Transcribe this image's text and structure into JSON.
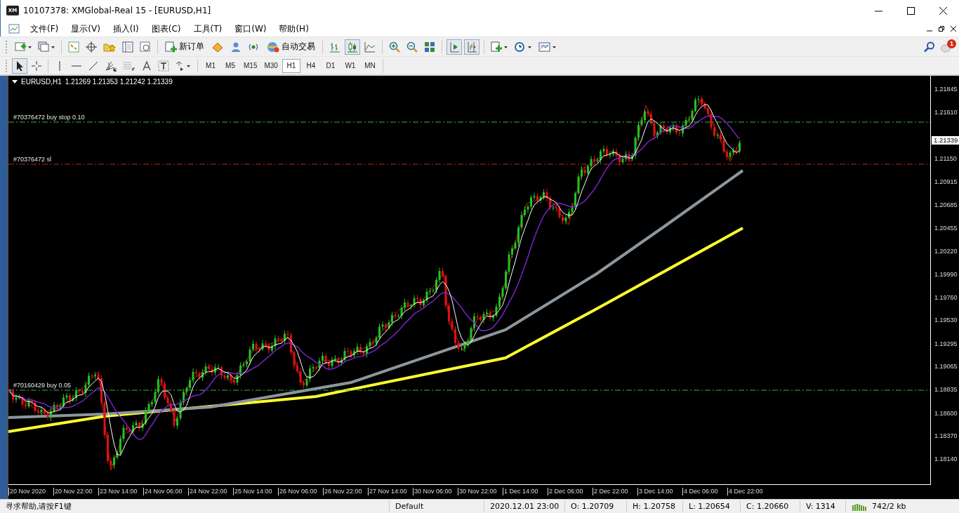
{
  "window": {
    "logo": "XM",
    "title": "10107378: XMGlobal-Real 15 - [EURUSD,H1]"
  },
  "menu": [
    {
      "label": "文件(F)"
    },
    {
      "label": "显示(V)"
    },
    {
      "label": "插入(I)"
    },
    {
      "label": "图表(C)"
    },
    {
      "label": "工具(T)"
    },
    {
      "label": "窗口(W)"
    },
    {
      "label": "帮助(H)"
    }
  ],
  "toolbar": {
    "new_order": "新订单",
    "auto_trading": "自动交易",
    "notification_count": "1",
    "chart_types": [
      {
        "kind": "bars",
        "selected": false
      },
      {
        "kind": "candles",
        "selected": true
      },
      {
        "kind": "line",
        "selected": false
      }
    ],
    "autoscroll": {
      "on": true
    },
    "chart_shift": {
      "on": true
    }
  },
  "drawing_tools": [
    {
      "kind": "cursor",
      "selected": true
    },
    {
      "kind": "crosshair",
      "selected": false
    }
  ],
  "timeframes": [
    {
      "label": "M1",
      "selected": false
    },
    {
      "label": "M5",
      "selected": false
    },
    {
      "label": "M15",
      "selected": false
    },
    {
      "label": "M30",
      "selected": false
    },
    {
      "label": "H1",
      "selected": true
    },
    {
      "label": "H4",
      "selected": false
    },
    {
      "label": "D1",
      "selected": false
    },
    {
      "label": "W1",
      "selected": false
    },
    {
      "label": "MN",
      "selected": false
    }
  ],
  "chart": {
    "symbol": "EURUSD,H1",
    "ohlc": "1.21269 1.21353 1.21242 1.21339",
    "current_price": "1.21339",
    "orders": [
      {
        "label": "#70376472 buy stop 0.10",
        "kind": "pending"
      },
      {
        "label": "#70376472 sl",
        "kind": "stop_loss"
      },
      {
        "label": "#70160429 buy 0.05",
        "kind": "position"
      }
    ],
    "price_ticks": [
      "1.21845",
      "1.21610",
      "1.21150",
      "1.20915",
      "1.20685",
      "1.20455",
      "1.20220",
      "1.19990",
      "1.19760",
      "1.19530",
      "1.19295",
      "1.19065",
      "1.18835",
      "1.18600",
      "1.18370",
      "1.18140"
    ],
    "time_labels": [
      "20 Nov 2020",
      "20 Nov 22:00",
      "23 Nov 14:00",
      "24 Nov 06:00",
      "24 Nov 22:00",
      "25 Nov 14:00",
      "26 Nov 06:00",
      "26 Nov 22:00",
      "27 Nov 14:00",
      "30 Nov 06:00",
      "30 Nov 22:00",
      "1 Dec 14:00",
      "2 Dec 06:00",
      "2 Dec 22:00",
      "3 Dec 14:00",
      "4 Dec 06:00",
      "4 Dec 22:00"
    ]
  },
  "status_bar": {
    "help": "寻求帮助,请按F1键",
    "profile": "Default",
    "time": "2020.12.01 23:00",
    "open": "O: 1.20709",
    "high": "H: 1.20758",
    "low": "L: 1.20654",
    "close": "C: 1.20660",
    "volume": "V: 1314",
    "traffic": "742/2 kb"
  }
}
